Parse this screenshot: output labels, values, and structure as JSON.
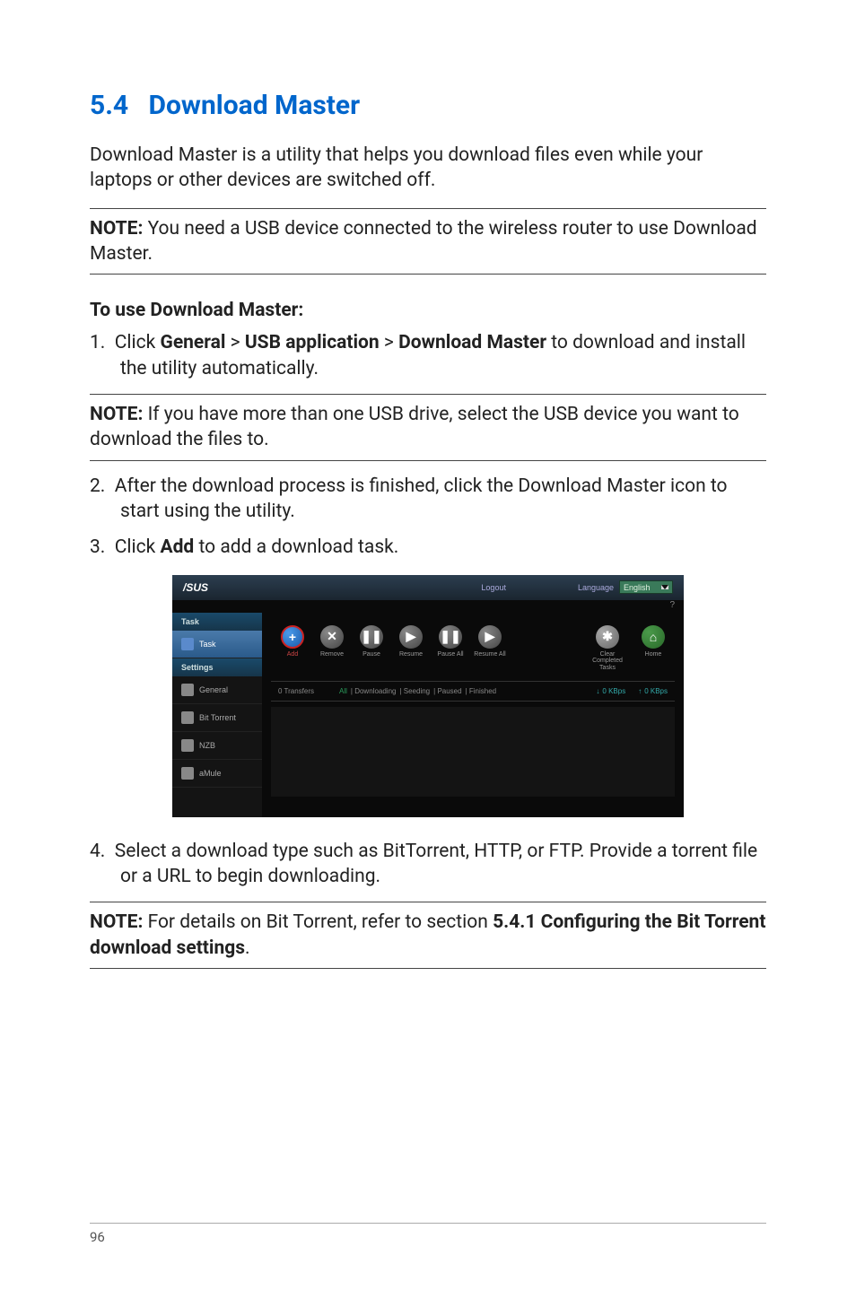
{
  "section": {
    "number": "5.4",
    "title": "Download Master"
  },
  "intro": "Download Master is a utility that helps you download files even while your laptops or other devices are switched off.",
  "note1": {
    "prefix": "NOTE:",
    "text": " You need a USB device connected to the wireless router to use Download Master."
  },
  "subheading": "To use Download Master:",
  "step1": {
    "num": "1.",
    "p1": "Click ",
    "b1": "General",
    "gt1": " > ",
    "b2": "USB application",
    "gt2": " > ",
    "b3": "Download Master",
    "p2": " to download and install the utility automatically."
  },
  "note2": {
    "prefix": "NOTE:",
    "text": "  If you have more than one USB drive, select the USB device you want to download the files to."
  },
  "step2": {
    "num": "2.",
    "text": "After the download process is finished, click the Download Master icon to start using the utility."
  },
  "step3": {
    "num": "3.",
    "p1": "Click ",
    "b1": "Add",
    "p2": " to add a download task."
  },
  "screenshot": {
    "logo": "/SUS",
    "logout": "Logout",
    "lang_label": "Language",
    "lang_value": "English",
    "help": "?",
    "sidebar": {
      "section_task": "Task",
      "item_task": "Task",
      "section_settings": "Settings",
      "item_general": "General",
      "item_bittorrent": "Bit Torrent",
      "item_nzb": "NZB",
      "item_amule": "aMule"
    },
    "toolbar": {
      "add": {
        "icon": "+",
        "label": "Add"
      },
      "remove": {
        "icon": "✕",
        "label": "Remove"
      },
      "pause": {
        "icon": "❚❚",
        "label": "Pause"
      },
      "resume": {
        "icon": "▶",
        "label": "Resume"
      },
      "pause_all": {
        "icon": "❚❚",
        "label": "Pause All"
      },
      "resume_all": {
        "icon": "▶",
        "label": "Resume All"
      },
      "clear": {
        "icon": "✱",
        "label": "Clear Completed Tasks"
      },
      "home": {
        "icon": "⌂",
        "label": "Home"
      }
    },
    "filters": {
      "transfers": "0 Transfers",
      "all": "All",
      "downloading": "| Downloading",
      "seeding": "| Seeding",
      "paused": "| Paused",
      "finished": "| Finished",
      "down_speed": "0 KBps",
      "up_speed": "0 KBps"
    }
  },
  "step4": {
    "num": "4.",
    "text": "Select a download type such as BitTorrent, HTTP, or FTP. Provide a torrent file or a URL to begin downloading."
  },
  "note3": {
    "prefix": "NOTE:",
    "p1": "  For details on Bit Torrent, refer to section ",
    "b1": "5.4.1 Configuring the Bit Torrent download settings",
    "p2": "."
  },
  "page_number": "96"
}
